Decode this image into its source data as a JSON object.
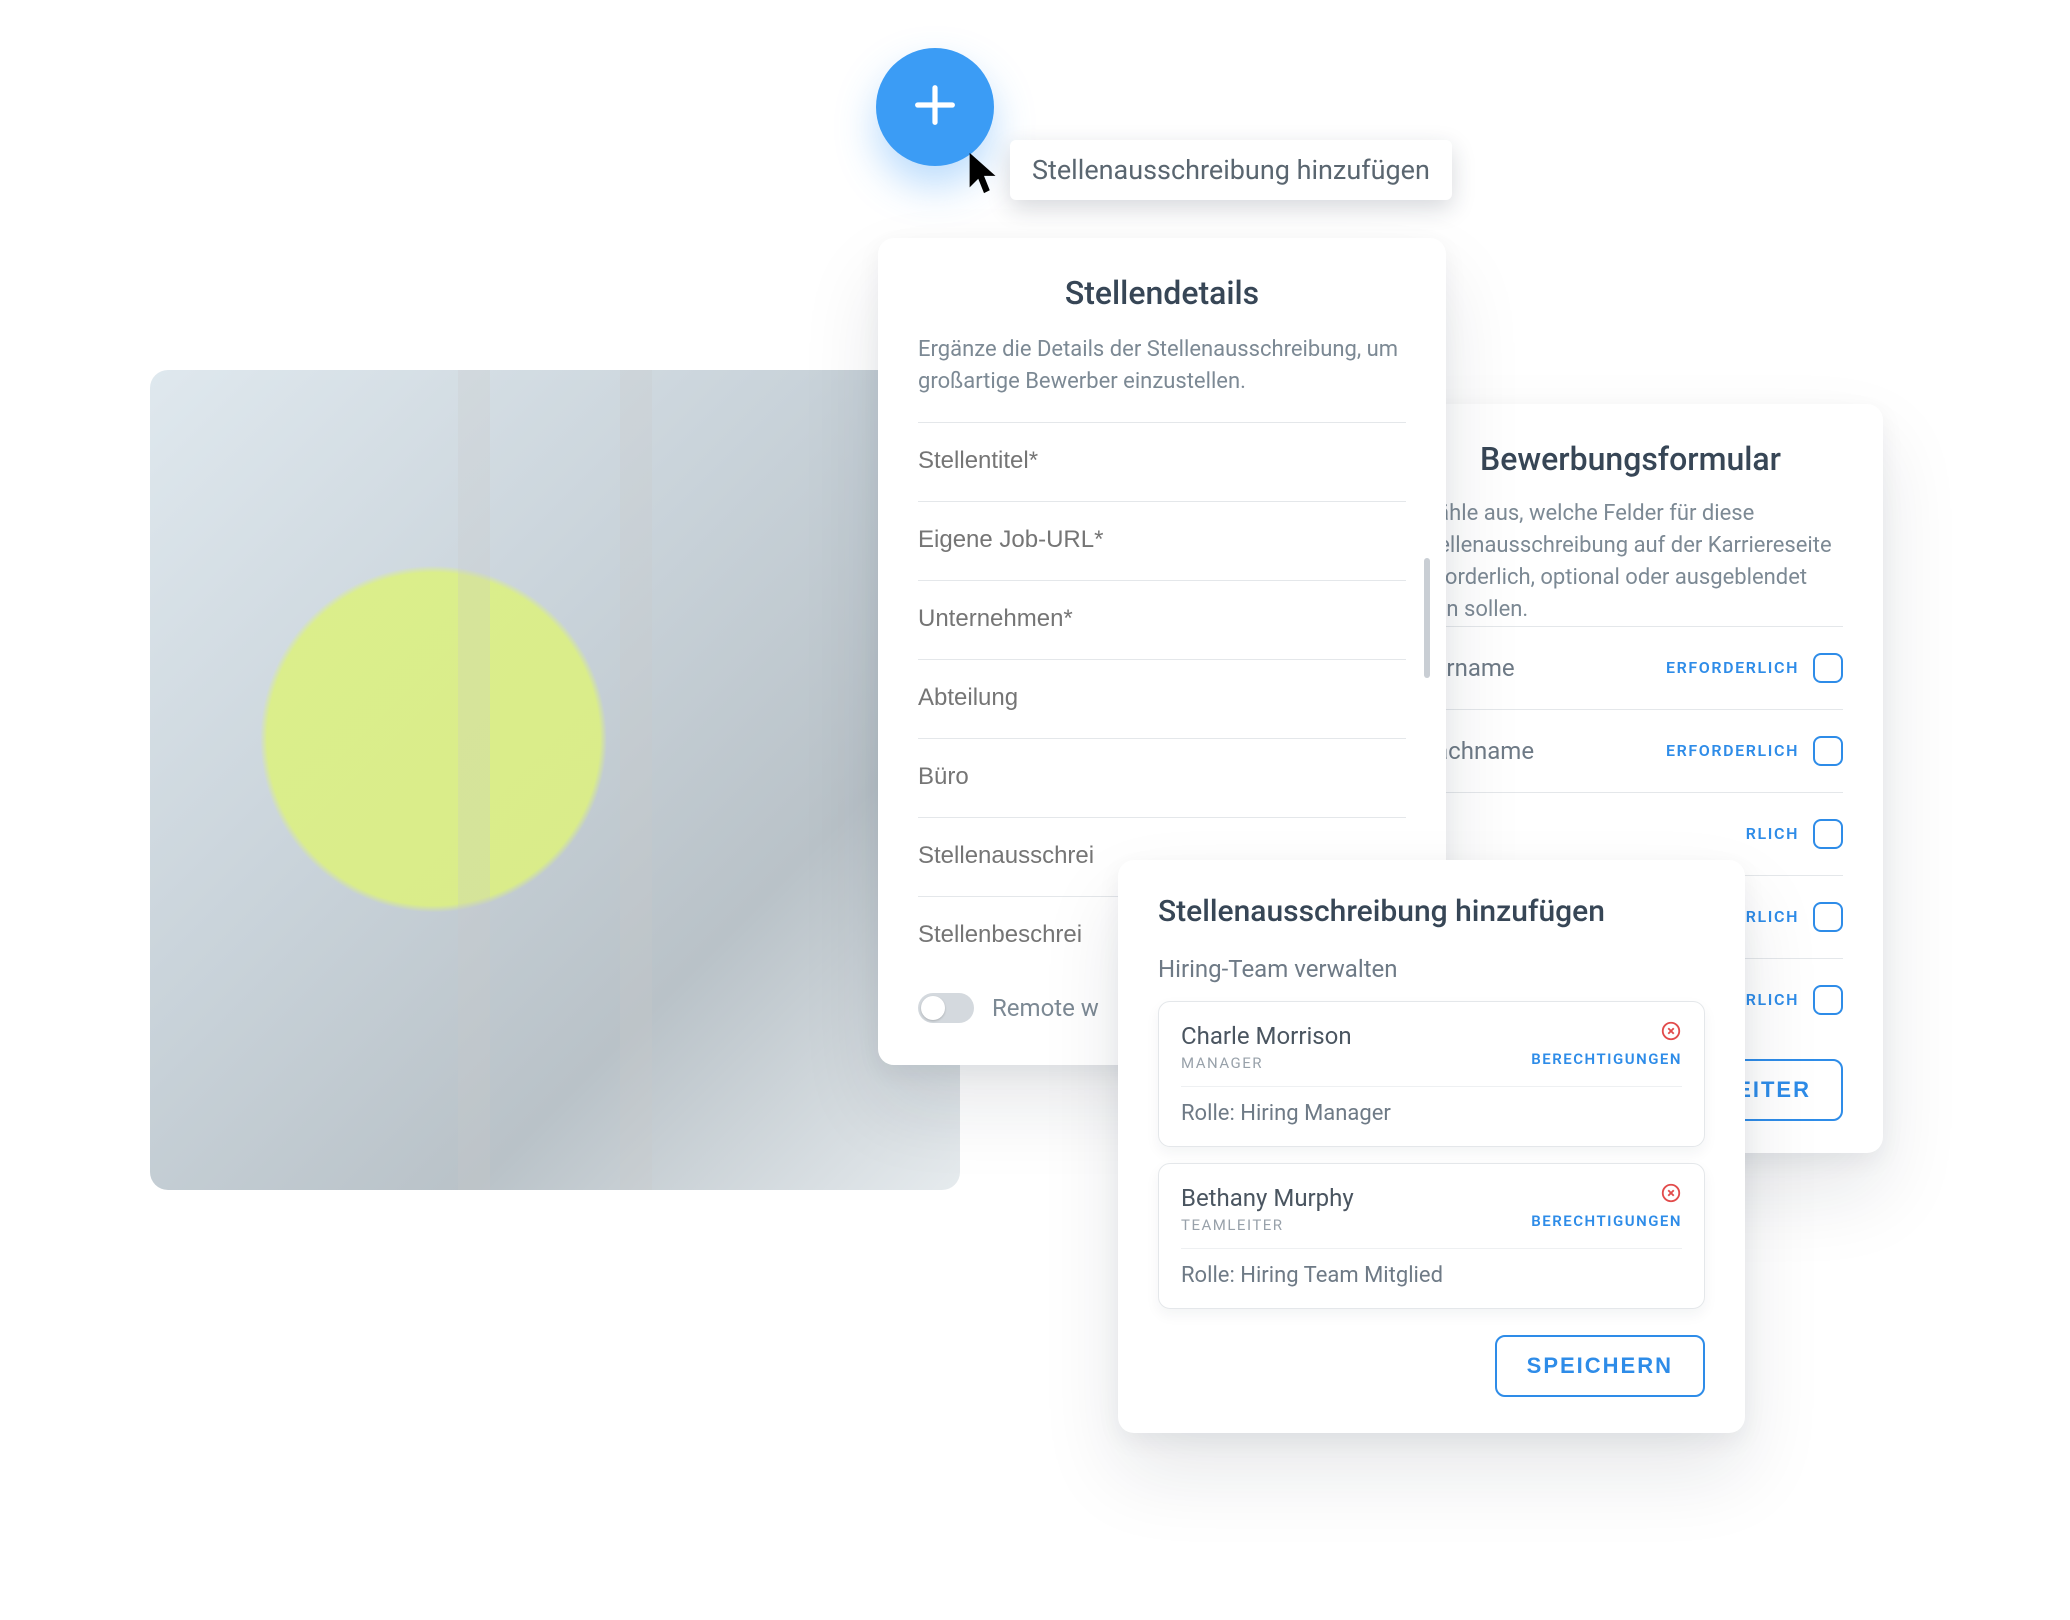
{
  "fab": {
    "tooltip": "Stellenausschreibung hinzufügen"
  },
  "details": {
    "title": "Stellendetails",
    "desc": "Ergänze die Details der Stellenausschreibung, um großartige Bewerber einzustellen.",
    "fields": {
      "stellentitel": "Stellentitel*",
      "joburl": "Eigene Job-URL*",
      "unternehmen": "Unternehmen*",
      "abteilung": "Abteilung",
      "buero": "Büro",
      "ausschreibung": "Stellenausschrei",
      "beschreibung": "Stellenbeschrei"
    },
    "remote_label": "Remote w"
  },
  "appform": {
    "title": "Bewerbungsformular",
    "desc": "Wähle aus, welche Felder für diese Stellenausschreibung auf der Karriereseite erforderlich, optional oder ausgeblendet sein sollen.",
    "required_label": "ERFORDERLICH",
    "rlich_fragment": "RLICH",
    "rows": {
      "vorname": "Vorname",
      "nachname": "Nachname"
    },
    "next": "WEITER"
  },
  "team": {
    "title": "Stellenausschreibung hinzufügen",
    "subtitle": "Hiring-Team verwalten",
    "permissions_label": "BERECHTIGUNGEN",
    "role_prefix": "Rolle: ",
    "members": [
      {
        "name": "Charle Morrison",
        "title": "MANAGER",
        "role": "Hiring Manager"
      },
      {
        "name": "Bethany Murphy",
        "title": "TEAMLEITER",
        "role": "Hiring Team Mitglied"
      }
    ],
    "save": "SPEICHERN"
  }
}
